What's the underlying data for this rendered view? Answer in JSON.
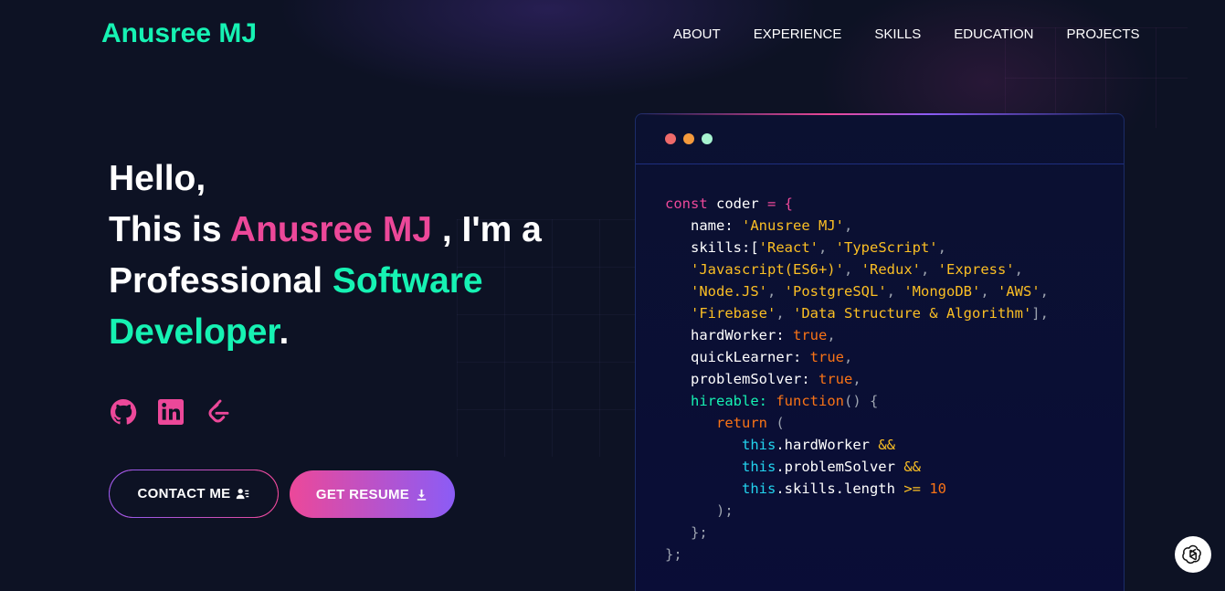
{
  "header": {
    "logo": "Anusree MJ",
    "nav": [
      "ABOUT",
      "EXPERIENCE",
      "SKILLS",
      "EDUCATION",
      "PROJECTS"
    ]
  },
  "hero": {
    "line1": "Hello,",
    "line2_prefix": "This is ",
    "name": "Anusree MJ",
    "line2_suffix": " , I'm a",
    "line3_prefix": "Professional ",
    "role_part1": "Software",
    "role_part2": "Developer",
    "end_period": "."
  },
  "socials": [
    "github-icon",
    "linkedin-icon",
    "leetcode-icon"
  ],
  "buttons": {
    "contact": "CONTACT ME",
    "resume": "GET RESUME"
  },
  "code_card": {
    "dot_colors": [
      "#ef6a6a",
      "#f59a3c",
      "#a7f3d0"
    ],
    "code": {
      "decl_kw": "const",
      "decl_name": " coder ",
      "decl_eq": "= {",
      "name_key": "name: ",
      "name_val": "'Anusree MJ'",
      "skills_key": "skills:[",
      "skills": [
        "'React'",
        "'TypeScript'",
        "'Javascript(ES6+)'",
        "'Redux'",
        "'Express'",
        "'Node.JS'",
        "'PostgreSQL'",
        "'MongoDB'",
        "'AWS'",
        "'Firebase'",
        "'Data Structure & Algorithm'"
      ],
      "hardWorker_key": "hardWorker: ",
      "quickLearner_key": "quickLearner: ",
      "problemSolver_key": "problemSolver: ",
      "true_val": "true",
      "hireable_key": "hireable: ",
      "function_kw": "function",
      "function_tail": "() {",
      "return_kw": "return",
      "return_paren": " (",
      "this_kw": "this",
      "hw_prop": ".hardWorker",
      "ps_prop": ".problemSolver",
      "sk_prop": ".skills.length",
      "and_op": "&&",
      "gte_op": ">=",
      "ten": "10",
      "close_paren": ");",
      "close_fn": "};",
      "close_obj": "};"
    }
  }
}
